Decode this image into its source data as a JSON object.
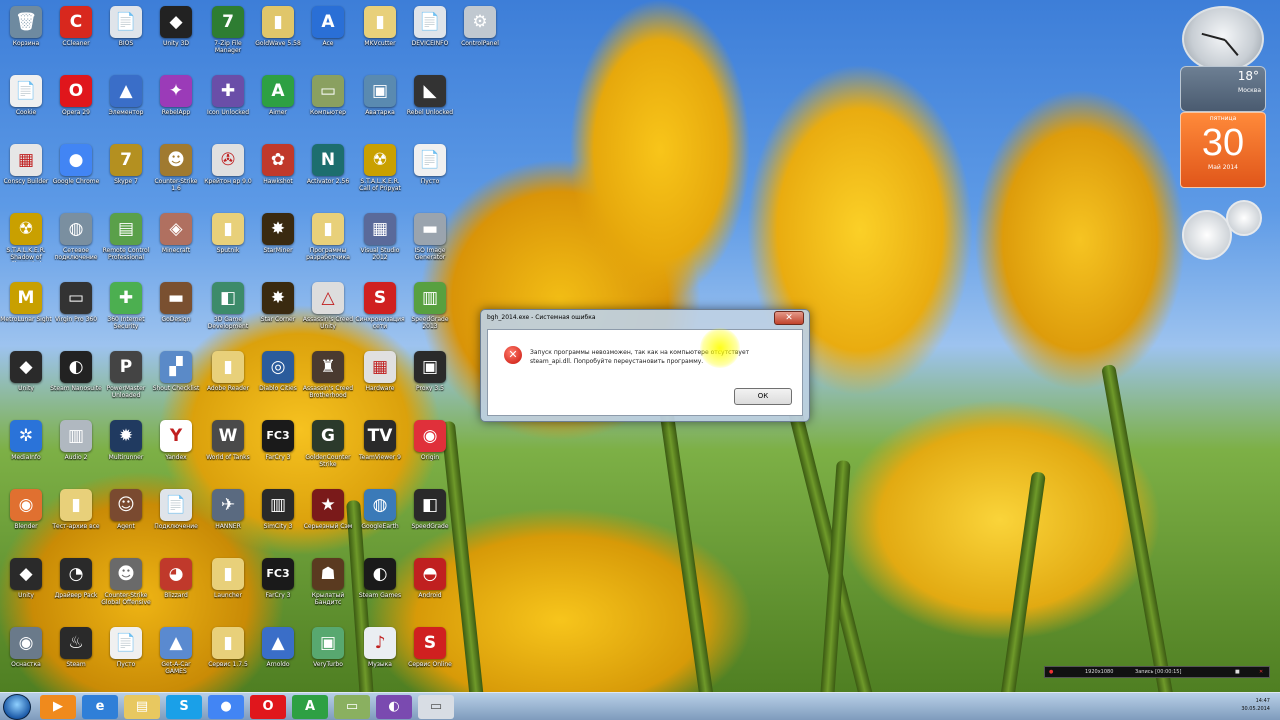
{
  "desktop_icons": [
    {
      "label": "Корзина",
      "color": "#6e8aa0",
      "glyph": "🗑"
    },
    {
      "label": "CCleaner",
      "color": "#d8281e",
      "glyph": "C"
    },
    {
      "label": "BIOS",
      "color": "#dfe4ea",
      "glyph": "📄"
    },
    {
      "label": "Unity 3D",
      "color": "#222222",
      "glyph": "◆"
    },
    {
      "label": "7-Zip File Manager",
      "color": "#2e7d32",
      "glyph": "7"
    },
    {
      "label": "GoldWave 5.58",
      "color": "#e0c66a",
      "glyph": "▮"
    },
    {
      "label": "Ace",
      "color": "#2a6fd6",
      "glyph": "A"
    },
    {
      "label": "MKVcutter",
      "color": "#e8d07a",
      "glyph": "▮"
    },
    {
      "label": "DEVICEINFO",
      "color": "#dfe4ea",
      "glyph": "📄"
    },
    {
      "label": "ControlPanel",
      "color": "#c0c8d0",
      "glyph": "⚙"
    },
    {
      "label": "Cookie",
      "color": "#f0f0f0",
      "glyph": "📄"
    },
    {
      "label": "Opera 29",
      "color": "#e0161c",
      "glyph": "O"
    },
    {
      "label": "Элементор",
      "color": "#3a6ec8",
      "glyph": "▲"
    },
    {
      "label": "RebelApp",
      "color": "#9b3bb8",
      "glyph": "✦"
    },
    {
      "label": "Icon Unlocked",
      "color": "#6a4ea8",
      "glyph": "✚"
    },
    {
      "label": "Aimer",
      "color": "#2ea043",
      "glyph": "A"
    },
    {
      "label": "Компьютер",
      "color": "#8aa060",
      "glyph": "▭"
    },
    {
      "label": "Аватарка",
      "color": "#5a8ab0",
      "glyph": "▣"
    },
    {
      "label": "Rebel Unlocked",
      "color": "#333333",
      "glyph": "◣"
    },
    {
      "label": "Conscy Builder",
      "color": "#e6e6e6",
      "glyph": "▦"
    },
    {
      "label": "Google Chrome",
      "color": "#4285f4",
      "glyph": "●"
    },
    {
      "label": "Skype 7",
      "color": "#b49020",
      "glyph": "7"
    },
    {
      "label": "Counter-Strike 1.6",
      "color": "#a07a30",
      "glyph": "☻"
    },
    {
      "label": "Крейтон вр 9.0",
      "color": "#e0e0e0",
      "glyph": "✇"
    },
    {
      "label": "Hawkshot",
      "color": "#c0392b",
      "glyph": "✿"
    },
    {
      "label": "Activator 2.56",
      "color": "#1d6e6e",
      "glyph": "N"
    },
    {
      "label": "S.T.A.L.K.E.R. Call of Pripyat",
      "color": "#c9a000",
      "glyph": "☢"
    },
    {
      "label": "Пусто",
      "color": "#f0f0f0",
      "glyph": "📄"
    },
    {
      "label": "S.T.A.L.K.E.R. Shadow of Chernobyl",
      "color": "#c9a000",
      "glyph": "☢"
    },
    {
      "label": "Сетевое подключение",
      "color": "#7a8fa0",
      "glyph": "◍"
    },
    {
      "label": "Remote Control Professional",
      "color": "#5aa04a",
      "glyph": "▤"
    },
    {
      "label": "Minecraft",
      "color": "#b07060",
      "glyph": "◈"
    },
    {
      "label": "Sputnik",
      "color": "#e8d07a",
      "glyph": "▮"
    },
    {
      "label": "StarMiner",
      "color": "#3a2a10",
      "glyph": "✸"
    },
    {
      "label": "Программы разработчика",
      "color": "#e8d07a",
      "glyph": "▮"
    },
    {
      "label": "Visual Studio 2012",
      "color": "#5a6a9a",
      "glyph": "▦"
    },
    {
      "label": "ISO Image Generator",
      "color": "#9aa4ae",
      "glyph": "▬"
    },
    {
      "label": "MetroLunar Sight",
      "color": "#c8a000",
      "glyph": "M"
    },
    {
      "label": "Virgin Pro 360",
      "color": "#333333",
      "glyph": "▭"
    },
    {
      "label": "360 Internet Security",
      "color": "#4caf50",
      "glyph": "✚"
    },
    {
      "label": "GoDesign",
      "color": "#7a5030",
      "glyph": "▬"
    },
    {
      "label": "3D Game Development",
      "color": "#3d8b6a",
      "glyph": "◧"
    },
    {
      "label": "Star Corner",
      "color": "#3a2a10",
      "glyph": "✸"
    },
    {
      "label": "Assassin's Creed Unity",
      "color": "#dddddd",
      "glyph": "△"
    },
    {
      "label": "Синхронизация сети",
      "color": "#d02020",
      "glyph": "S"
    },
    {
      "label": "SpeedGrade 2013",
      "color": "#58a040",
      "glyph": "▥"
    },
    {
      "label": "Unity",
      "color": "#2a2a2a",
      "glyph": "◆"
    },
    {
      "label": "Steam Nanosuite",
      "color": "#222222",
      "glyph": "◐"
    },
    {
      "label": "PowerMaster Unloaded",
      "color": "#444444",
      "glyph": "P"
    },
    {
      "label": "Shout Checklist",
      "color": "#5a8ac8",
      "glyph": "▞"
    },
    {
      "label": "Adobe Reader",
      "color": "#e8d07a",
      "glyph": "▮"
    },
    {
      "label": "Diablo Cities",
      "color": "#2b5c9c",
      "glyph": "◎"
    },
    {
      "label": "Assassin's Creed Brotherhood",
      "color": "#4a3a30",
      "glyph": "♜"
    },
    {
      "label": "Hardware",
      "color": "#e0e0e0",
      "glyph": "▦"
    },
    {
      "label": "Proxy 3.5",
      "color": "#2a2a2a",
      "glyph": "▣"
    },
    {
      "label": "MediaInfo",
      "color": "#2a73d9",
      "glyph": "✲"
    },
    {
      "label": "Audio 2",
      "color": "#b0b8c0",
      "glyph": "▥"
    },
    {
      "label": "Multirunner",
      "color": "#203a60",
      "glyph": "✹"
    },
    {
      "label": "Yandex",
      "color": "#ffffff",
      "glyph": "Y"
    },
    {
      "label": "World of Tanks",
      "color": "#4a4a4a",
      "glyph": "W"
    },
    {
      "label": "FarCry 3",
      "color": "#1a1a1a",
      "glyph": "FC3"
    },
    {
      "label": "GoldenCounter Strike",
      "color": "#2b3a2b",
      "glyph": "G"
    },
    {
      "label": "TeamViewer 9",
      "color": "#2a2a2a",
      "glyph": "TV"
    },
    {
      "label": "Origin",
      "color": "#e0303a",
      "glyph": "◉"
    },
    {
      "label": "Blender",
      "color": "#e07030",
      "glyph": "◉"
    },
    {
      "label": "Тест-архив все",
      "color": "#e8d07a",
      "glyph": "▮"
    },
    {
      "label": "Agent",
      "color": "#7a4a30",
      "glyph": "☺"
    },
    {
      "label": "Подключение",
      "color": "#dfe4ea",
      "glyph": "📄"
    },
    {
      "label": "HANNER",
      "color": "#5a6a80",
      "glyph": "✈"
    },
    {
      "label": "SimCity 3",
      "color": "#2a2a2a",
      "glyph": "▥"
    },
    {
      "label": "Серьезный Сэм",
      "color": "#7a1a1a",
      "glyph": "★"
    },
    {
      "label": "GoogleEarth",
      "color": "#3a7ab8",
      "glyph": "◍"
    },
    {
      "label": "SpeedGrade",
      "color": "#2a2a2a",
      "glyph": "◧"
    },
    {
      "label": "Unity",
      "color": "#2a2a2a",
      "glyph": "◆"
    },
    {
      "label": "Драйвер Pack",
      "color": "#2a2a2a",
      "glyph": "◔"
    },
    {
      "label": "Counter-Strike Global Offensive",
      "color": "#6a6a6a",
      "glyph": "☻"
    },
    {
      "label": "Blizzard",
      "color": "#c0392b",
      "glyph": "◕"
    },
    {
      "label": "Launcher",
      "color": "#e8d07a",
      "glyph": "▮"
    },
    {
      "label": "FarCry 3",
      "color": "#1a1a1a",
      "glyph": "FC3"
    },
    {
      "label": "Крылатый Бандитс",
      "color": "#5a3a20",
      "glyph": "☗"
    },
    {
      "label": "Steam Games",
      "color": "#1a1a1a",
      "glyph": "◐"
    },
    {
      "label": "Android",
      "color": "#c02020",
      "glyph": "◓"
    },
    {
      "label": "Оснастка",
      "color": "#6a7a8a",
      "glyph": "◉"
    },
    {
      "label": "Steam",
      "color": "#2a2a2a",
      "glyph": "♨"
    },
    {
      "label": "Пусто",
      "color": "#f0f0f0",
      "glyph": "📄"
    },
    {
      "label": "Get-A-Car GAMES",
      "color": "#5a8ad0",
      "glyph": "▲"
    },
    {
      "label": "Сервис 1.7.5",
      "color": "#e8d07a",
      "glyph": "▮"
    },
    {
      "label": "Arnoldo",
      "color": "#3a6ec8",
      "glyph": "▲"
    },
    {
      "label": "VeryTurbo",
      "color": "#58a870",
      "glyph": "▣"
    },
    {
      "label": "Музыка",
      "color": "#eaeef2",
      "glyph": "♪"
    },
    {
      "label": "Сервис Online",
      "color": "#d02020",
      "glyph": "S"
    }
  ],
  "gadgets": {
    "weather_temp": "18°",
    "weather_city": "Москва",
    "calendar_dow": "пятница",
    "calendar_day": "30",
    "calendar_month": "Май 2014"
  },
  "dialog": {
    "title": "bgh_2014.exe - Системная ошибка",
    "message": "Запуск программы невозможен, так как на компьютере отсутствует steam_api.dll. Попробуйте переустановить программу.",
    "ok_label": "ОК",
    "close_glyph": "✕"
  },
  "recorder": {
    "resolution": "1920x1080",
    "status": "Запись [00:00:15]"
  },
  "taskbar": {
    "apps": [
      {
        "name": "media-player",
        "color": "#f08a1c",
        "glyph": "▶"
      },
      {
        "name": "internet-explorer",
        "color": "#2f7fd8",
        "glyph": "e"
      },
      {
        "name": "file-explorer",
        "color": "#e8c860",
        "glyph": "▤"
      },
      {
        "name": "skype",
        "color": "#1aa0e8",
        "glyph": "S"
      },
      {
        "name": "google-chrome",
        "color": "#4285f4",
        "glyph": "●"
      },
      {
        "name": "opera",
        "color": "#e0161c",
        "glyph": "O"
      },
      {
        "name": "aimer",
        "color": "#2ea043",
        "glyph": "A"
      },
      {
        "name": "notes",
        "color": "#8ab060",
        "glyph": "▭"
      },
      {
        "name": "browser-arc",
        "color": "#7a4ab0",
        "glyph": "◐"
      },
      {
        "name": "error-window",
        "color": "#d8dde4",
        "glyph": "▭"
      }
    ],
    "time": "14:47",
    "date": "30.05.2014"
  }
}
